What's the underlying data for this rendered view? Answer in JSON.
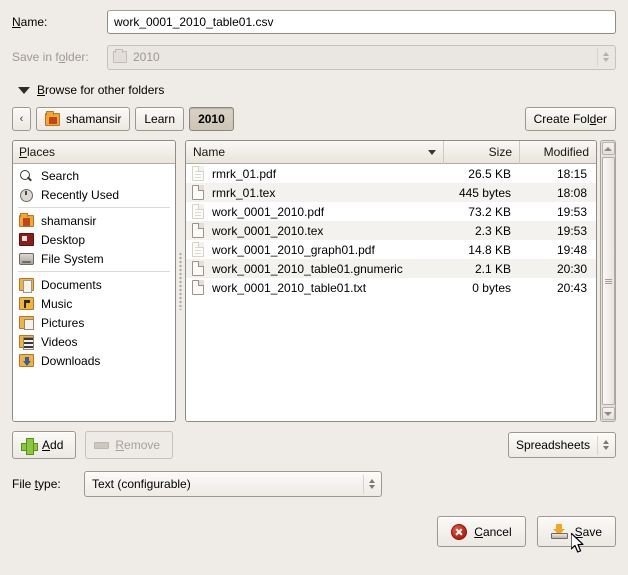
{
  "fields": {
    "name_label": "Name:",
    "name_value": "work_0001_2010_table01.csv",
    "folder_label": "Save in folder:",
    "folder_value": "2010",
    "expander_label": "Browse for other folders"
  },
  "breadcrumb": {
    "back_glyph": "‹",
    "items": [
      {
        "label": "shamansir",
        "icon": "home-icon",
        "active": false
      },
      {
        "label": "Learn",
        "icon": "",
        "active": false
      },
      {
        "label": "2010",
        "icon": "",
        "active": true
      }
    ],
    "create_folder_label": "Create Folder"
  },
  "places": {
    "header": "Places",
    "items": [
      {
        "label": "Search",
        "icon": "search-icon"
      },
      {
        "label": "Recently Used",
        "icon": "clock-icon"
      },
      {
        "label": "shamansir",
        "icon": "home-folder-icon"
      },
      {
        "label": "Desktop",
        "icon": "desktop-icon"
      },
      {
        "label": "File System",
        "icon": "hard-drive-icon"
      },
      {
        "label": "Documents",
        "icon": "documents-folder-icon"
      },
      {
        "label": "Music",
        "icon": "music-folder-icon"
      },
      {
        "label": "Pictures",
        "icon": "pictures-folder-icon"
      },
      {
        "label": "Videos",
        "icon": "videos-folder-icon"
      },
      {
        "label": "Downloads",
        "icon": "downloads-folder-icon"
      }
    ]
  },
  "files": {
    "columns": [
      "Name",
      "Size",
      "Modified"
    ],
    "sort_column": "Name",
    "sort_direction": "descending",
    "rows": [
      {
        "name": "rmrk_01.pdf",
        "size": "26.5 KB",
        "modified": "18:15",
        "icon": "pdf-document-icon"
      },
      {
        "name": "rmrk_01.tex",
        "size": "445 bytes",
        "modified": "18:08",
        "icon": "text-document-icon"
      },
      {
        "name": "work_0001_2010.pdf",
        "size": "73.2 KB",
        "modified": "19:53",
        "icon": "pdf-document-icon"
      },
      {
        "name": "work_0001_2010.tex",
        "size": "2.3 KB",
        "modified": "19:53",
        "icon": "text-document-icon"
      },
      {
        "name": "work_0001_2010_graph01.pdf",
        "size": "14.8 KB",
        "modified": "19:48",
        "icon": "pdf-document-icon"
      },
      {
        "name": "work_0001_2010_table01.gnumeric",
        "size": "2.1 KB",
        "modified": "20:30",
        "icon": "text-document-icon"
      },
      {
        "name": "work_0001_2010_table01.txt",
        "size": "0 bytes",
        "modified": "20:43",
        "icon": "text-document-icon"
      }
    ]
  },
  "bottom": {
    "add_label": "Add",
    "remove_label": "Remove",
    "filter_value": "Spreadsheets",
    "file_type_label": "File type:",
    "file_type_value": "Text (configurable)",
    "cancel_label": "Cancel",
    "save_label": "Save"
  },
  "colors": {
    "window_bg": "#efebe7",
    "pane_bg": "#ffffff",
    "row_alt": "#f4f2ef",
    "border": "#908b84",
    "accent_folder": "#f0a830",
    "cancel_red": "#b41e12",
    "add_green": "#8cc63e"
  }
}
